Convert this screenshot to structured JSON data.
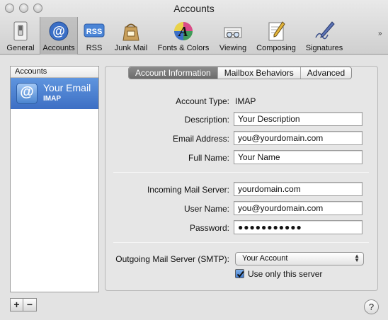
{
  "window": {
    "title": "Accounts"
  },
  "toolbar": {
    "items": [
      {
        "label": "General",
        "icon": "general-switch-icon"
      },
      {
        "label": "Accounts",
        "icon": "at-sign-icon",
        "selected": true
      },
      {
        "label": "RSS",
        "icon": "rss-icon"
      },
      {
        "label": "Junk Mail",
        "icon": "junk-mail-bag-icon"
      },
      {
        "label": "Fonts & Colors",
        "icon": "fonts-colors-icon"
      },
      {
        "label": "Viewing",
        "icon": "viewing-glasses-icon"
      },
      {
        "label": "Composing",
        "icon": "composing-pencil-icon"
      },
      {
        "label": "Signatures",
        "icon": "signatures-pen-icon"
      }
    ],
    "overflow_glyph": "»"
  },
  "accounts_list": {
    "header": "Accounts",
    "items": [
      {
        "name": "Your Email",
        "type": "IMAP",
        "icon_glyph": "@"
      }
    ],
    "add_label": "+",
    "remove_label": "−"
  },
  "tabs": [
    "Account Information",
    "Mailbox Behaviors",
    "Advanced"
  ],
  "account_info": {
    "account_type_label": "Account Type:",
    "account_type_value": "IMAP",
    "description_label": "Description:",
    "description_value": "Your Description",
    "email_label": "Email Address:",
    "email_value": "you@yourdomain.com",
    "fullname_label": "Full Name:",
    "fullname_value": "Your Name",
    "incoming_label": "Incoming Mail Server:",
    "incoming_value": "yourdomain.com",
    "username_label": "User Name:",
    "username_value": "you@yourdomain.com",
    "password_label": "Password:",
    "password_value": "●●●●●●●●●●●",
    "smtp_label": "Outgoing Mail Server (SMTP):",
    "smtp_value": "Your Account",
    "only_server_label": "Use only this server",
    "only_server_checked": true
  },
  "help_label": "?",
  "colors": {
    "selection_blue": "#3d6fc4",
    "active_tab": "#6b6b6b"
  }
}
